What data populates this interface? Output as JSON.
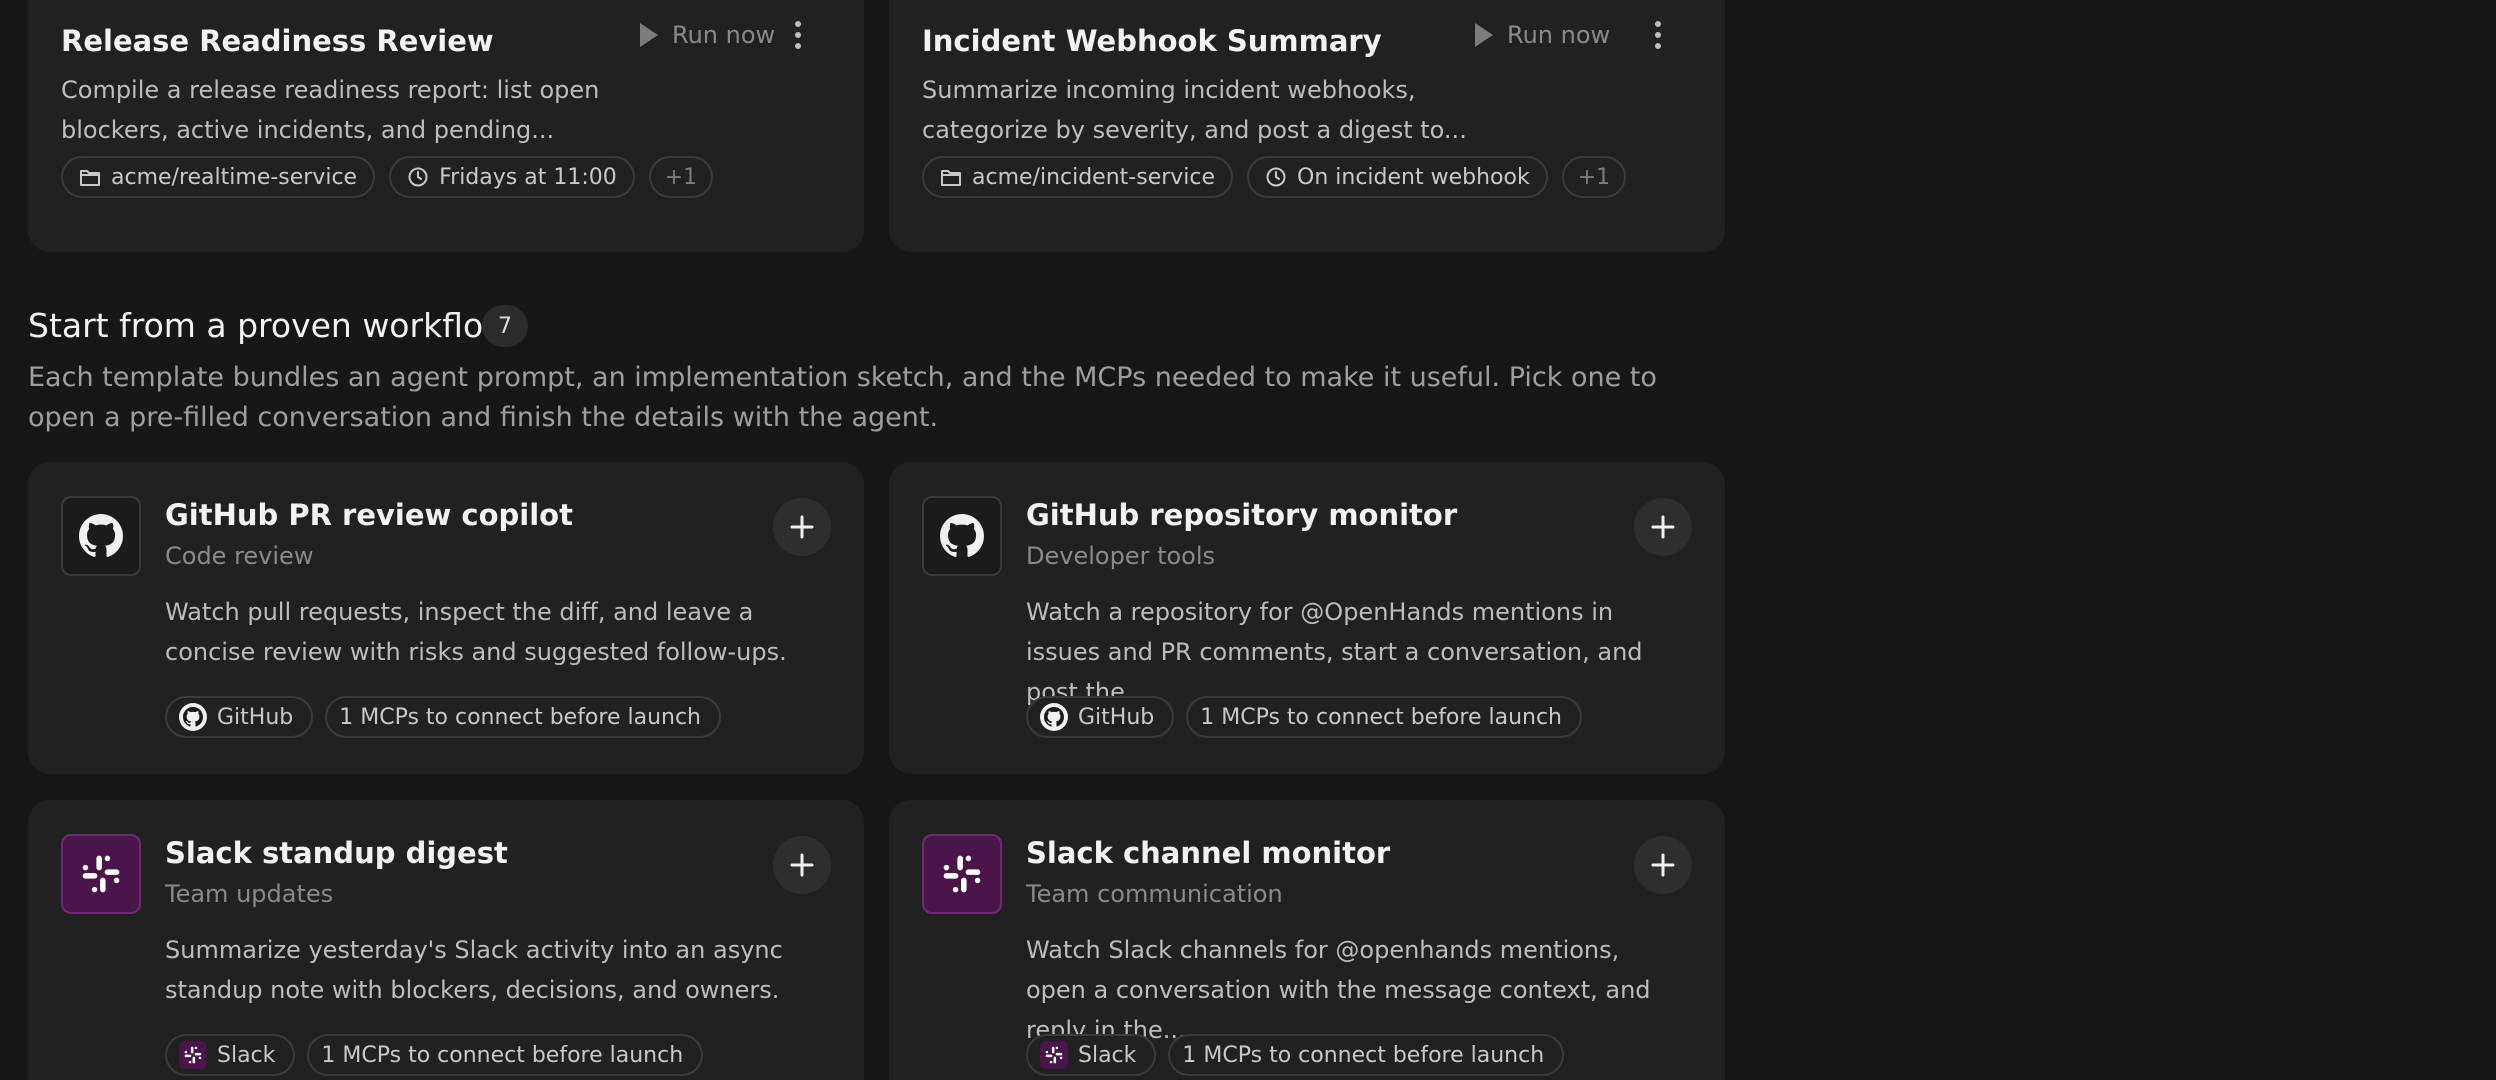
{
  "automations": [
    {
      "title": "Release Readiness Review",
      "description": "Compile a release readiness report: list open blockers, active incidents, and pending...",
      "run_label": "Run now",
      "repo": "acme/realtime-service",
      "schedule": "Fridays at 11:00",
      "extra": "+1"
    },
    {
      "title": "Incident Webhook Summary",
      "description": "Summarize incoming incident webhooks, categorize by severity, and post a digest to...",
      "run_label": "Run now",
      "repo": "acme/incident-service",
      "schedule": "On incident webhook",
      "extra": "+1"
    }
  ],
  "section": {
    "title": "Start from a proven workflow",
    "count": "7",
    "description": "Each template bundles an agent prompt, an implementation sketch, and the MCPs needed to make it useful. Pick one to open a pre-filled conversation and finish the details with the agent."
  },
  "templates": [
    {
      "title": "GitHub PR review copilot",
      "category": "Code review",
      "description": "Watch pull requests, inspect the diff, and leave a concise review with risks and suggested follow-ups.",
      "integration": "GitHub",
      "mcp_note": "1 MCPs to connect before launch"
    },
    {
      "title": "GitHub repository monitor",
      "category": "Developer tools",
      "description": "Watch a repository for @OpenHands mentions in issues and PR comments, start a conversation, and post the...",
      "integration": "GitHub",
      "mcp_note": "1 MCPs to connect before launch"
    },
    {
      "title": "Slack standup digest",
      "category": "Team updates",
      "description": "Summarize yesterday's Slack activity into an async standup note with blockers, decisions, and owners.",
      "integration": "Slack",
      "mcp_note": "1 MCPs to connect before launch"
    },
    {
      "title": "Slack channel monitor",
      "category": "Team communication",
      "description": "Watch Slack channels for @openhands mentions, open a conversation with the message context, and reply in the...",
      "integration": "Slack",
      "mcp_note": "1 MCPs to connect before launch"
    }
  ],
  "colors": {
    "background": "#171717",
    "card": "#212121",
    "slack_brand": "#4a154b"
  },
  "icons": {
    "run": "play-icon",
    "menu": "kebab-menu-icon",
    "repo": "folder-icon",
    "schedule": "clock-icon",
    "add": "plus-icon",
    "github": "github-logo-icon",
    "slack": "slack-logo-icon"
  }
}
